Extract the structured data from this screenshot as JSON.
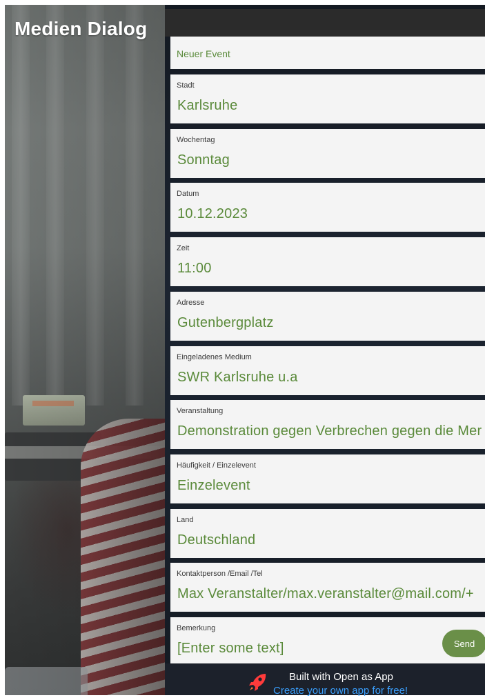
{
  "app": {
    "title": "Medien Dialog"
  },
  "form": {
    "new_event_label": "Neuer Event",
    "fields": [
      {
        "label": "Stadt",
        "value": "Karlsruhe"
      },
      {
        "label": "Wochentag",
        "value": "Sonntag"
      },
      {
        "label": "Datum",
        "value": "10.12.2023"
      },
      {
        "label": "Zeit",
        "value": "11:00"
      },
      {
        "label": "Adresse",
        "value": "Gutenbergplatz"
      },
      {
        "label": "Eingeladenes Medium",
        "value": "SWR Karlsruhe u.a"
      },
      {
        "label": "Veranstaltung",
        "value": "Demonstration gegen Verbrechen gegen die Mer"
      },
      {
        "label": "Häufigkeit / Einzelevent",
        "value": "Einzelevent"
      },
      {
        "label": "Land",
        "value": "Deutschland"
      },
      {
        "label": "Kontaktperson /Email /Tel",
        "value": "Max Veranstalter/max.veranstalter@mail.com/+"
      }
    ],
    "remark": {
      "label": "Bemerkung",
      "placeholder": "[Enter some text]"
    },
    "send_label": "Send"
  },
  "footer": {
    "line1": "Built with Open as App",
    "line2": "Create your own app for free!"
  },
  "colors": {
    "accent_green": "#5a8a3a",
    "send_button": "#6a8f48",
    "link_blue": "#3aa0ff",
    "rocket_red": "#ff3b3b",
    "panel_dark": "#1c2430"
  },
  "icons": {
    "footer_icon": "rocket-icon"
  }
}
